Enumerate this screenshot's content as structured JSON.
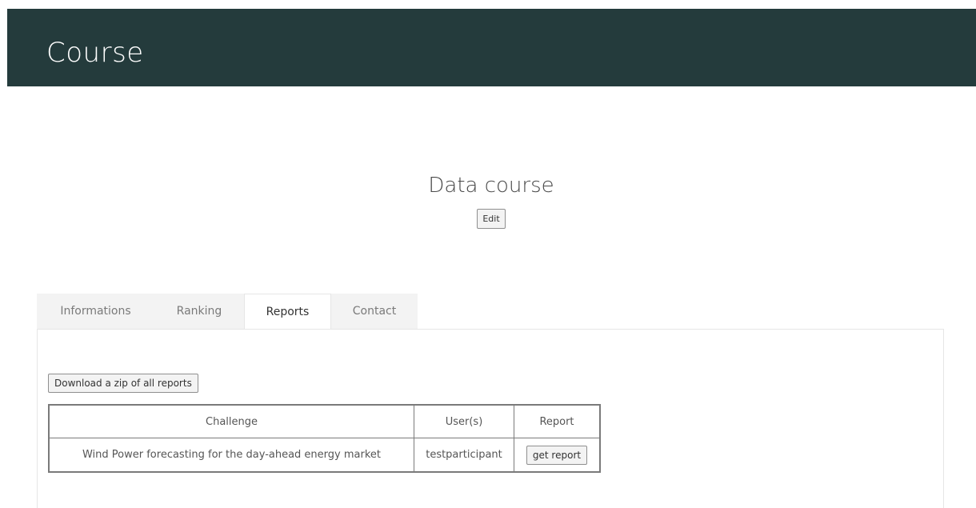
{
  "header": {
    "title": "Course"
  },
  "course": {
    "title": "Data course",
    "edit_label": "Edit"
  },
  "tabs": [
    {
      "label": "Informations",
      "active": false
    },
    {
      "label": "Ranking",
      "active": false
    },
    {
      "label": "Reports",
      "active": true
    },
    {
      "label": "Contact",
      "active": false
    }
  ],
  "reports": {
    "download_label": "Download a zip of all reports",
    "columns": [
      "Challenge",
      "User(s)",
      "Report"
    ],
    "rows": [
      {
        "challenge": "Wind Power forecasting for the day-ahead energy market",
        "users": "testparticipant",
        "report_label": "get report"
      }
    ]
  },
  "colors": {
    "header_bg": "#243b3c",
    "tab_inactive_bg": "#f3f3f3",
    "table_border": "#7a7a7a"
  }
}
